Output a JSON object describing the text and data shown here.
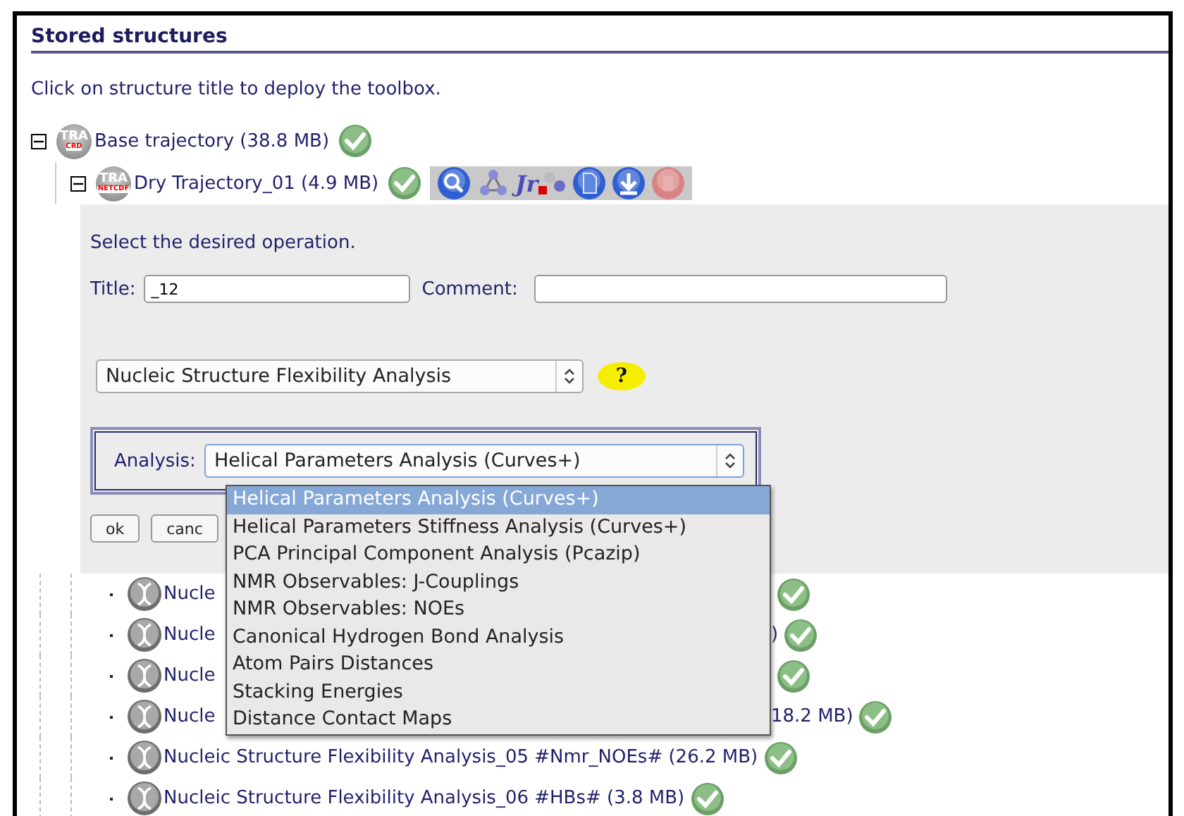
{
  "section": {
    "title": "Stored structures",
    "instruction": "Click on structure title to deploy the toolbox."
  },
  "tree": {
    "label": "Base trajectory (38.8 MB)",
    "badge": "TRA",
    "format": "CRD",
    "expanded": true,
    "children": [
      {
        "label": "Dry Trajectory_01 (4.9 MB)",
        "badge": "TRA",
        "format": "NETCDF",
        "expanded": true,
        "toolbar": [
          {
            "kind": "search"
          },
          {
            "kind": "molecule"
          },
          {
            "kind": "jmol",
            "text": "Jr"
          },
          {
            "kind": "document"
          },
          {
            "kind": "download"
          },
          {
            "kind": "delete"
          }
        ],
        "panel": {
          "prompt": "Select the desired operation.",
          "title_label": "Title:",
          "title_value": "_12",
          "comment_label": "Comment:",
          "operation": "Nucleic Structure Flexibility Analysis",
          "help": "?",
          "analysis_label": "Analysis:",
          "analysis_value": "Helical Parameters Analysis (Curves+)",
          "analysis_options": [
            {
              "label": "Helical Parameters Analysis (Curves+)",
              "selected": true
            },
            {
              "label": "Helical Parameters Stiffness Analysis (Curves+)",
              "selected": false
            },
            {
              "label": "PCA Principal Component Analysis (Pcazip)",
              "selected": false
            },
            {
              "label": "NMR Observables: J-Couplings",
              "selected": false
            },
            {
              "label": "NMR Observables: NOEs",
              "selected": false
            },
            {
              "label": "Canonical Hydrogen Bond Analysis",
              "selected": false
            },
            {
              "label": "Atom Pairs Distances",
              "selected": false
            },
            {
              "label": "Stacking Energies",
              "selected": false
            },
            {
              "label": "Distance Contact Maps",
              "selected": false
            }
          ],
          "buttons": [
            "ok",
            "canc"
          ]
        },
        "children": [
          {
            "label": "Nucle",
            "covered": true
          },
          {
            "label": "Nucle",
            "tail": ")",
            "covered": true
          },
          {
            "label": "Nucle",
            "covered": true
          },
          {
            "label": "Nucle",
            "tail": "18.2 MB)",
            "covered": true
          },
          {
            "label": "Nucleic Structure Flexibility Analysis_05 #Nmr_NOEs# (26.2 MB)",
            "covered": false
          },
          {
            "label": "Nucleic Structure Flexibility Analysis_06 #HBs# (3.8 MB)",
            "covered": false
          }
        ]
      }
    ]
  }
}
